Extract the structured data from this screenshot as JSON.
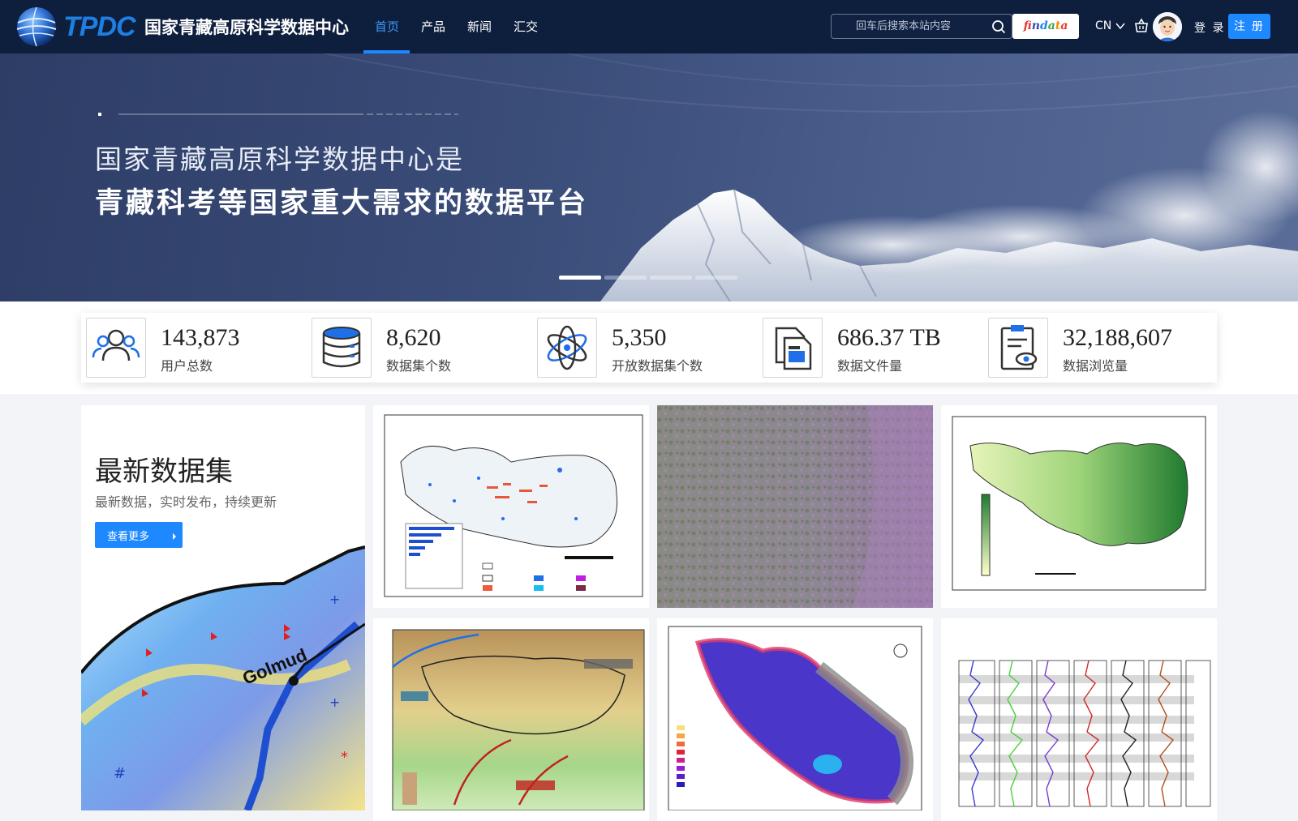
{
  "header": {
    "logo_mark": "TPDC",
    "logo_text": "国家青藏高原科学数据中心",
    "nav": [
      {
        "label": "首页",
        "active": true
      },
      {
        "label": "产品",
        "active": false
      },
      {
        "label": "新闻",
        "active": false
      },
      {
        "label": "汇交",
        "active": false
      }
    ],
    "search_placeholder": "回车后搜索本站内容",
    "findata_label": "findata",
    "lang": "CN",
    "login": "登 录",
    "register": "注 册"
  },
  "hero": {
    "line1": "国家青藏高原科学数据中心是",
    "line2": "青藏科考等国家重大需求的数据平台",
    "slides": 4,
    "active_slide": 0
  },
  "stats": [
    {
      "value": "143,873",
      "label": "用户总数",
      "icon": "users-icon"
    },
    {
      "value": "8,620",
      "label": "数据集个数",
      "icon": "database-icon"
    },
    {
      "value": "5,350",
      "label": "开放数据集个数",
      "icon": "atom-icon"
    },
    {
      "value": "686.37 TB",
      "label": "数据文件量",
      "icon": "files-icon"
    },
    {
      "value": "32,188,607",
      "label": "数据浏览量",
      "icon": "clipboard-eye-icon"
    }
  ],
  "latest": {
    "title": "最新数据集",
    "subtitle": "最新数据，实时发布，持续更新",
    "more_label": "查看更多",
    "map_label": "Golmud"
  },
  "thumbnails": [
    {
      "name": "lakes-map-thumbnail"
    },
    {
      "name": "vegetation-photo-thumbnail"
    },
    {
      "name": "soil-moisture-map-thumbnail"
    },
    {
      "name": "monsoon-elevation-map-thumbnail"
    },
    {
      "name": "permafrost-map-thumbnail"
    },
    {
      "name": "depth-profile-chart-thumbnail"
    }
  ],
  "colors": {
    "header_bg": "#0e1e3d",
    "accent": "#1e88ff",
    "nav_active": "#3a9cff"
  }
}
